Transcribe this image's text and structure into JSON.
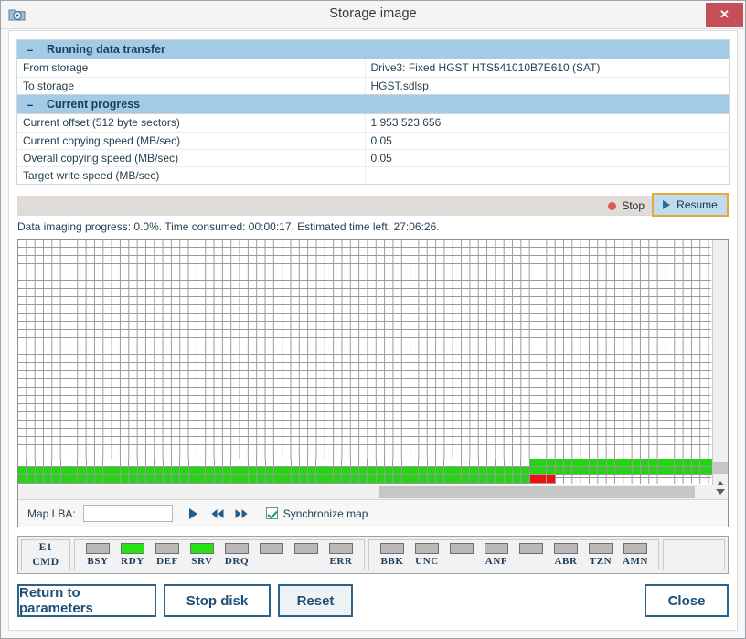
{
  "window": {
    "title": "Storage image",
    "app_icon": "folder-disk-icon",
    "close_label": "✕"
  },
  "groups": [
    {
      "id": "running-data-transfer",
      "collapse_glyph": "–",
      "title": "Running data transfer",
      "rows": [
        {
          "key": "From storage",
          "value": "Drive3: Fixed HGST HTS541010B7E610 (SAT)"
        },
        {
          "key": "To storage",
          "value": "HGST.sdlsp"
        }
      ]
    },
    {
      "id": "current-progress",
      "collapse_glyph": "–",
      "title": "Current progress",
      "rows": [
        {
          "key": "Current offset (512 byte sectors)",
          "value": "1 953 523 656"
        },
        {
          "key": "Current copying speed (MB/sec)",
          "value": "0.05"
        },
        {
          "key": "Overall copying speed (MB/sec)",
          "value": "0.05"
        },
        {
          "key": "Target write speed (MB/sec)",
          "value": ""
        }
      ]
    }
  ],
  "progress": {
    "percent": 0.0,
    "percent_label": "0.0%",
    "status_text": "Data imaging progress: 0.0%. Time consumed: 00:00:17. Estimated time left: 27:06:26.",
    "stop_label": "Stop",
    "resume_label": "Resume",
    "bar_color": "#dedcd9",
    "resume_highlight_color": "#e8a939"
  },
  "map": {
    "colors": {
      "done": "#25d515",
      "bad": "#f01010",
      "empty": "#ffffff",
      "grid": "#9a9a9a"
    },
    "rows": [
      {
        "offset": 60,
        "cells": "gggggggggggggggggggggggggggggggggggggggggggggggggggggggggggggggggggggggggggg"
      },
      {
        "offset": 0,
        "cells": "gggggggggggggggggggggggggggggggggggggggggggggggggggggggggggggggggggggggggggggggggggggggggggggggggggggggggggggggggggggggggggggggggggg"
      },
      {
        "offset": 0,
        "cells": "ggggggggggggggggggggggggggggggggggggggggggggggggggggggggggggrrr"
      }
    ],
    "controls": {
      "lba_label": "Map LBA:",
      "lba_value": "",
      "lba_placeholder": "",
      "goto_icon": "play-icon",
      "prev_icon": "rewind-icon",
      "next_icon": "fast-forward-icon",
      "sync_label": "Synchronize map",
      "sync_checked": true
    },
    "scroll": {
      "vertical_position": "bottom",
      "horizontal_position": "right"
    }
  },
  "status_leds": {
    "command_block": {
      "line1": "E1",
      "line2": "CMD"
    },
    "groups": [
      {
        "name": "status-register",
        "leds": [
          {
            "label": "BSY",
            "on": false
          },
          {
            "label": "RDY",
            "on": true
          },
          {
            "label": "DEF",
            "on": false
          },
          {
            "label": "SRV",
            "on": true
          },
          {
            "label": "DRQ",
            "on": false
          },
          {
            "label": "",
            "on": false
          },
          {
            "label": "",
            "on": false
          },
          {
            "label": "ERR",
            "on": false
          }
        ]
      },
      {
        "name": "error-register",
        "leds": [
          {
            "label": "BBK",
            "on": false
          },
          {
            "label": "UNC",
            "on": false
          },
          {
            "label": "",
            "on": false
          },
          {
            "label": "ANF",
            "on": false
          },
          {
            "label": "",
            "on": false
          },
          {
            "label": "ABR",
            "on": false
          },
          {
            "label": "TZN",
            "on": false
          },
          {
            "label": "AMN",
            "on": false
          }
        ]
      }
    ]
  },
  "buttons": {
    "return": "Return to parameters",
    "stop_disk": "Stop disk",
    "reset": "Reset",
    "close": "Close"
  }
}
